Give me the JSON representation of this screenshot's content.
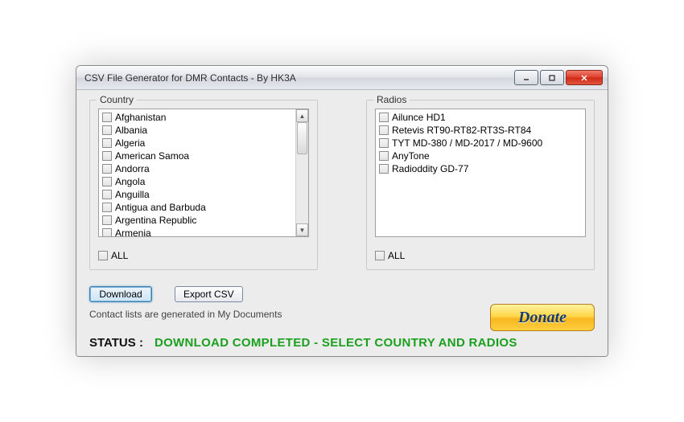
{
  "window": {
    "title": "CSV File Generator for DMR Contacts - By HK3A"
  },
  "country": {
    "legend": "Country",
    "items": [
      "Afghanistan",
      "Albania",
      "Algeria",
      "American Samoa",
      "Andorra",
      "Angola",
      "Anguilla",
      "Antigua and Barbuda",
      "Argentina Republic",
      "Armenia"
    ],
    "all_label": "ALL"
  },
  "radios": {
    "legend": "Radios",
    "items": [
      "Ailunce HD1",
      "Retevis RT90-RT82-RT3S-RT84",
      "TYT MD-380 / MD-2017 / MD-9600",
      "AnyTone",
      "Radioddity GD-77"
    ],
    "all_label": "ALL"
  },
  "buttons": {
    "download": "Download",
    "export": "Export CSV"
  },
  "hint": "Contact lists are generated in My Documents",
  "donate": "Donate",
  "status": {
    "label": "STATUS :",
    "message": "DOWNLOAD COMPLETED - SELECT COUNTRY AND RADIOS"
  }
}
